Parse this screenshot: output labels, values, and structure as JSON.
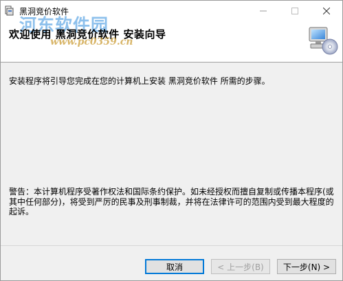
{
  "window": {
    "title": "黑洞竞价软件"
  },
  "banner": {
    "title": "欢迎使用 黑洞竞价软件 安装向导",
    "watermark_text": "河东软件园",
    "watermark_url": "www.pc0359.cn"
  },
  "content": {
    "intro": "安装程序将引导您完成在您的计算机上安装 黑洞竞价软件 所需的步骤。",
    "warning": "警告：本计算机程序受著作权法和国际条约保护。如未经授权而擅自复制或传播本程序(或其中任何部分)，将受到严厉的民事及刑事制裁，并将在法律许可的范围内受到最大程度的起诉。"
  },
  "buttons": {
    "cancel": "取消",
    "back": "< 上一步(B)",
    "next": "下一步(N) >"
  },
  "colors": {
    "focus_border": "#0078d7",
    "watermark_blue": "#308cdc",
    "watermark_orange": "#c89628"
  }
}
